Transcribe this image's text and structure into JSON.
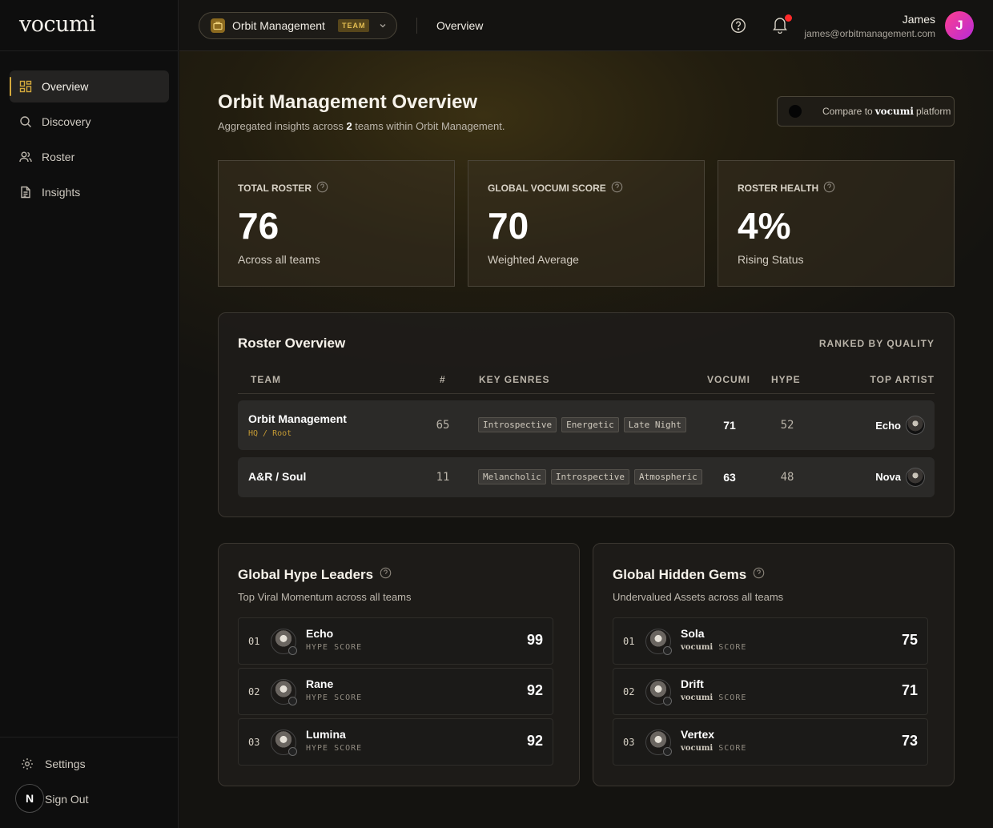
{
  "brand": "vocumi",
  "sidebar": {
    "items": [
      {
        "label": "Overview",
        "icon": "grid-icon"
      },
      {
        "label": "Discovery",
        "icon": "search-icon"
      },
      {
        "label": "Roster",
        "icon": "users-icon"
      },
      {
        "label": "Insights",
        "icon": "document-icon"
      }
    ],
    "settings_label": "Settings",
    "signout_label": "Sign Out",
    "badge_letter": "N"
  },
  "topbar": {
    "org_name": "Orbit Management",
    "org_badge": "TEAM",
    "breadcrumb": "Overview",
    "user_name": "James",
    "user_email": "james@orbitmanagement.com",
    "avatar_letter": "J"
  },
  "header": {
    "title": "Orbit Management Overview",
    "subtitle_pre": "Aggregated insights across",
    "subtitle_count": "2",
    "subtitle_post": "teams within Orbit Management.",
    "compare_pre": "Compare to",
    "compare_brand": "vocumi",
    "compare_post": "platform"
  },
  "stats": [
    {
      "label": "TOTAL ROSTER",
      "value": "76",
      "desc": "Across all teams"
    },
    {
      "label": "GLOBAL VOCUMI SCORE",
      "value": "70",
      "desc": "Weighted Average"
    },
    {
      "label": "ROSTER HEALTH",
      "value": "4%",
      "desc": "Rising Status"
    }
  ],
  "roster": {
    "title": "Roster Overview",
    "ranked_label": "RANKED BY QUALITY",
    "columns": [
      "TEAM",
      "#",
      "KEY GENRES",
      "VOCUMI",
      "HYPE",
      "TOP ARTIST"
    ],
    "rows": [
      {
        "team": "Orbit Management",
        "sub": "HQ / Root",
        "count": "65",
        "genres": [
          "Introspective",
          "Energetic",
          "Late Night"
        ],
        "vocumi": "71",
        "hype": "52",
        "artist": "Echo"
      },
      {
        "team": "A&R / Soul",
        "sub": "",
        "count": "11",
        "genres": [
          "Melancholic",
          "Introspective",
          "Atmospheric"
        ],
        "vocumi": "63",
        "hype": "48",
        "artist": "Nova"
      }
    ]
  },
  "hype_leaders": {
    "title": "Global Hype Leaders",
    "subtitle": "Top Viral Momentum across all teams",
    "score_label": "HYPE SCORE",
    "items": [
      {
        "rank": "01",
        "name": "Echo",
        "score": "99"
      },
      {
        "rank": "02",
        "name": "Rane",
        "score": "92"
      },
      {
        "rank": "03",
        "name": "Lumina",
        "score": "92"
      }
    ]
  },
  "hidden_gems": {
    "title": "Global Hidden Gems",
    "subtitle": "Undervalued Assets across all teams",
    "score_brand": "vocumi",
    "score_label": "SCORE",
    "items": [
      {
        "rank": "01",
        "name": "Sola",
        "score": "75"
      },
      {
        "rank": "02",
        "name": "Drift",
        "score": "71"
      },
      {
        "rank": "03",
        "name": "Vertex",
        "score": "73"
      }
    ]
  },
  "colors": {
    "accent": "#d4a93c",
    "notification": "#ff2a2a",
    "avatar": "#d42fb0"
  }
}
